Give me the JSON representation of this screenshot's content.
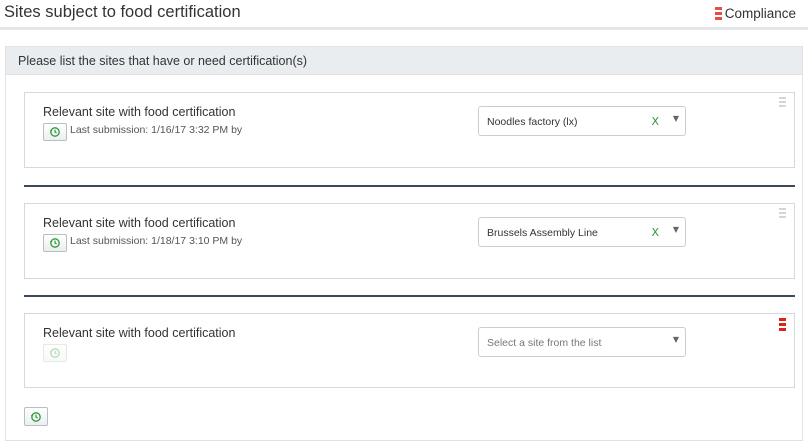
{
  "header": {
    "title": "Sites subject to food certification",
    "compliance_label": "Compliance"
  },
  "panel": {
    "heading": "Please list the sites that have or need certification(s)"
  },
  "entries": [
    {
      "label": "Relevant site with food certification",
      "last_submission": "Last submission: 1/16/17 3:32 PM by",
      "selected_site": "Noodles factory (lx)",
      "clear_label": "X",
      "caret": "▼"
    },
    {
      "label": "Relevant site with food certification",
      "last_submission": "Last submission: 1/18/17 3:10 PM by",
      "selected_site": "Brussels Assembly Line",
      "clear_label": "X",
      "caret": "▼"
    },
    {
      "label": "Relevant site with food certification",
      "placeholder": "Select a site from the list",
      "caret": "▼"
    }
  ],
  "icons": {
    "history": "history-icon",
    "drag": "drag-handle-icon",
    "compliance": "compliance-stack-icon"
  },
  "colors": {
    "accent_red": "#e3504a",
    "active_handle": "#d9261c",
    "clear_green": "#2d9a3a",
    "divider": "#3b4a5a",
    "panel_heading_bg": "#e9edf0"
  }
}
